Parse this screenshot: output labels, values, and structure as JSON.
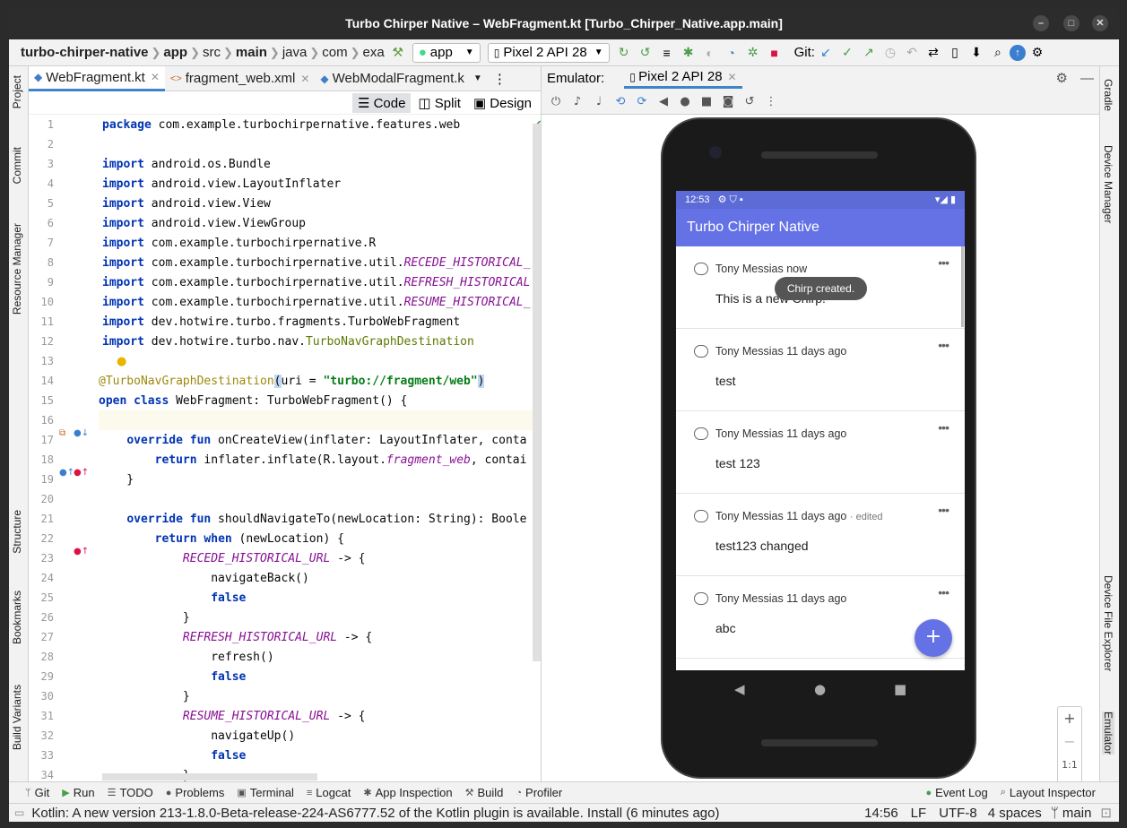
{
  "window": {
    "title": "Turbo Chirper Native – WebFragment.kt [Turbo_Chirper_Native.app.main]"
  },
  "nav": {
    "crumbs": [
      "turbo-chirper-native",
      "app",
      "src",
      "main",
      "java",
      "com",
      "exa"
    ],
    "run_config": "app",
    "device": "Pixel 2 API 28",
    "git_label": "Git:"
  },
  "left_tabs": [
    "Project",
    "Commit",
    "Resource Manager",
    "Structure",
    "Bookmarks",
    "Build Variants"
  ],
  "right_tabs": [
    "Gradle",
    "Device Manager",
    "Device File Explorer",
    "Emulator"
  ],
  "editor_tabs": [
    {
      "label": "WebFragment.kt",
      "icon": "kotlin-file-icon"
    },
    {
      "label": "fragment_web.xml",
      "icon": "xml-file-icon"
    },
    {
      "label": "WebModalFragment.k",
      "icon": "kotlin-file-icon"
    }
  ],
  "modes": {
    "code": "Code",
    "split": "Split",
    "design": "Design"
  },
  "emulator": {
    "label": "Emulator:",
    "tab": "Pixel 2 API 28"
  },
  "code": {
    "lines": [
      "1",
      "2",
      "3",
      "4",
      "5",
      "6",
      "7",
      "8",
      "9",
      "10",
      "11",
      "12",
      "13",
      "14",
      "15",
      "16",
      "17",
      "18",
      "19",
      "20",
      "21",
      "22",
      "23",
      "24",
      "25",
      "26",
      "27",
      "28",
      "29",
      "30",
      "31",
      "32",
      "33",
      "34"
    ]
  },
  "phone": {
    "time": "12:53",
    "app_title": "Turbo Chirper Native",
    "toast": "Chirp created.",
    "fab": "+",
    "chirps": [
      {
        "author": "Tony Messias now",
        "body": "This is a new Chirp!",
        "edited": ""
      },
      {
        "author": "Tony Messias 11 days ago",
        "body": "test",
        "edited": ""
      },
      {
        "author": "Tony Messias 11 days ago",
        "body": "test 123",
        "edited": ""
      },
      {
        "author": "Tony Messias 11 days ago",
        "body": "test123 changed",
        "edited": "· edited"
      },
      {
        "author": "Tony Messias 11 days ago",
        "body": "abc",
        "edited": ""
      }
    ]
  },
  "zoom": {
    "in": "+",
    "out": "−",
    "ratio": "1:1"
  },
  "toolwindows": [
    "Git",
    "Run",
    "TODO",
    "Problems",
    "Terminal",
    "Logcat",
    "App Inspection",
    "Build",
    "Profiler",
    "Event Log",
    "Layout Inspector"
  ],
  "status": {
    "message": "Kotlin: A new version 213-1.8.0-Beta-release-224-AS6777.52 of the Kotlin plugin is available. Install (6 minutes ago)",
    "position": "14:56",
    "line_sep": "LF",
    "encoding": "UTF-8",
    "indent": "4 spaces",
    "branch": "main"
  }
}
